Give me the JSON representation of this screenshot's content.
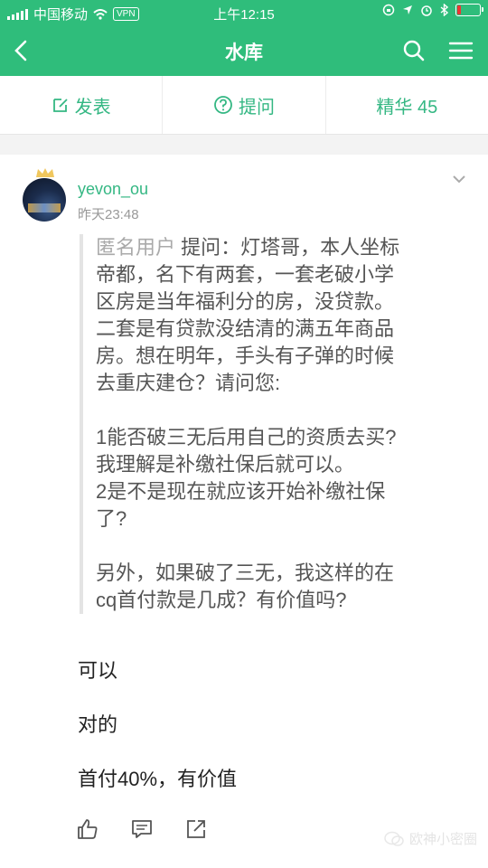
{
  "status_bar": {
    "carrier": "中国移动",
    "vpn": "VPN",
    "time": "上午12:15"
  },
  "nav": {
    "title": "水库",
    "icons": [
      "back-icon",
      "search-icon",
      "menu-icon"
    ]
  },
  "tabs": [
    {
      "label": "发表",
      "icon": "edit-icon"
    },
    {
      "label": "提问",
      "icon": "question-icon"
    },
    {
      "label": "精华 45"
    }
  ],
  "post": {
    "username": "yevon_ou",
    "time": "昨天23:48",
    "quote": {
      "asker": "匿名用户",
      "lines": [
        "提问：灯塔哥，本人坐标",
        "帝都，名下有两套，一套老破小学",
        "区房是当年福利分的房，没贷款。",
        "二套是有贷款没结清的满五年商品",
        "房。想在明年，手头有子弹的时候",
        "去重庆建仓？请问您:",
        "",
        "1能否破三无后用自己的资质去买?",
        "我理解是补缴社保后就可以。",
        "2是不是现在就应该开始补缴社保",
        "了?",
        "",
        "另外，如果破了三无，我这样的在",
        "cq首付款是几成？有价值吗?"
      ]
    },
    "answers": [
      "可以",
      "对的",
      "首付40%，有价值"
    ],
    "actions": [
      "like-icon",
      "comment-icon",
      "share-icon"
    ]
  },
  "watermark": "欧神小密圈",
  "colors": {
    "accent": "#2fbd7b",
    "tab_text": "#34b783"
  }
}
